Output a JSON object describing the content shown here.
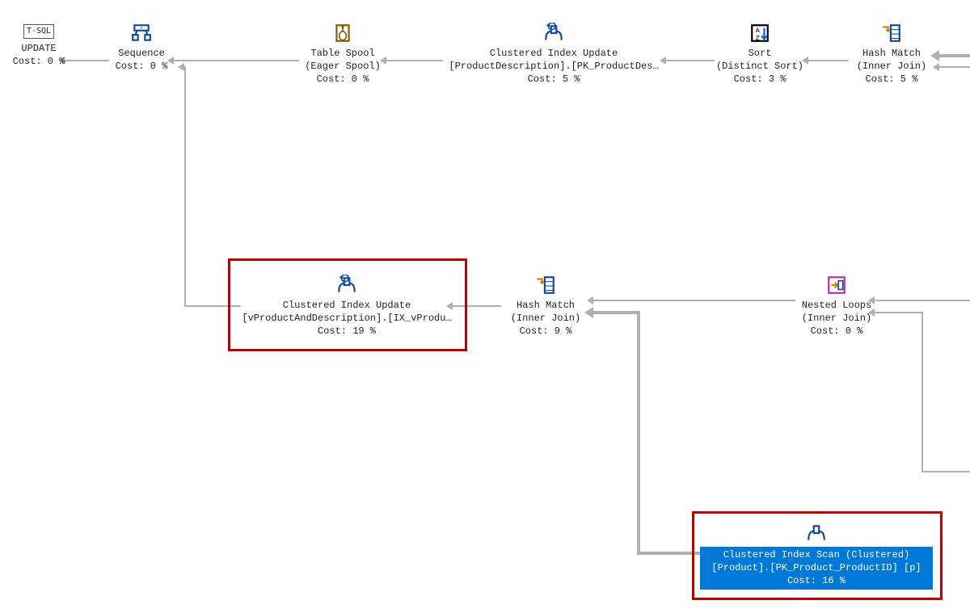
{
  "nodes": {
    "tsql": {
      "header": "T-SQL",
      "line1": "UPDATE",
      "cost": "Cost: 0 %"
    },
    "sequence": {
      "line1": "Sequence",
      "cost": "Cost: 0 %"
    },
    "tablespool": {
      "line1": "Table Spool",
      "line2": "(Eager Spool)",
      "cost": "Cost: 0 %"
    },
    "ciu1": {
      "line1": "Clustered Index Update",
      "line2": "[ProductDescription].[PK_ProductDes…",
      "cost": "Cost: 5 %"
    },
    "sort": {
      "line1": "Sort",
      "line2": "(Distinct Sort)",
      "cost": "Cost: 3 %"
    },
    "hash1": {
      "line1": "Hash Match",
      "line2": "(Inner Join)",
      "cost": "Cost: 5 %"
    },
    "ciu2": {
      "line1": "Clustered Index Update",
      "line2": "[vProductAndDescription].[IX_vProdu…",
      "cost": "Cost: 19 %"
    },
    "hash2": {
      "line1": "Hash Match",
      "line2": "(Inner Join)",
      "cost": "Cost: 9 %"
    },
    "nested": {
      "line1": "Nested Loops",
      "line2": "(Inner Join)",
      "cost": "Cost: 0 %"
    },
    "ciscan": {
      "line1": "Clustered Index Scan (Clustered)",
      "line2": "[Product].[PK_Product_ProductID] [p]",
      "cost": "Cost: 16 %"
    }
  }
}
